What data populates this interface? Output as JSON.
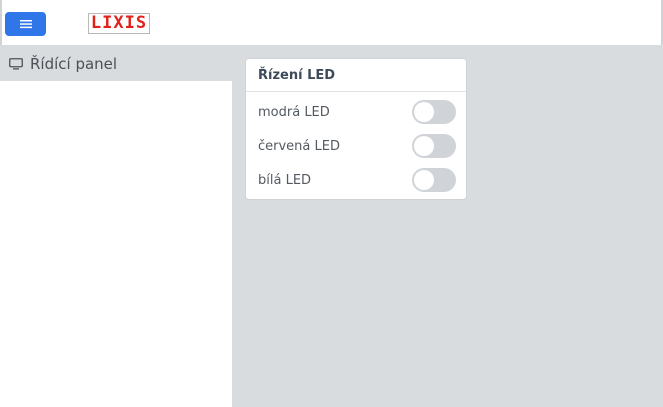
{
  "header": {
    "menu_icon": "hamburger-menu-icon",
    "logo_text": "LIXIS",
    "logo_color": "#e1211b",
    "accent_color": "#2f76e8"
  },
  "sidebar": {
    "icon": "monitor-icon",
    "title": "Řídící panel"
  },
  "card": {
    "title": "Řízení LED",
    "items": [
      {
        "label": "modrá LED",
        "enabled": false
      },
      {
        "label": "červená LED",
        "enabled": false
      },
      {
        "label": "bílá LED",
        "enabled": false
      }
    ]
  }
}
